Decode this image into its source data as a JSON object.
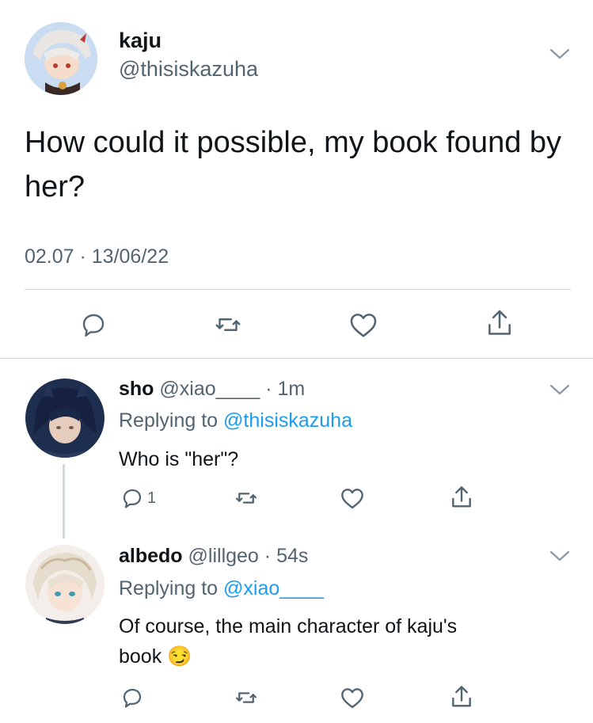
{
  "main_tweet": {
    "display_name": "kaju",
    "handle": "@thisiskazuha",
    "text": "How could it possible, my book found by her?",
    "timestamp": "02.07 · 13/06/22",
    "actions": [
      "reply-icon",
      "retweet-icon",
      "like-icon",
      "share-icon"
    ]
  },
  "replies": [
    {
      "display_name": "sho",
      "handle": "@xiao____",
      "time": "· 1m",
      "replying_prefix": "Replying to ",
      "replying_to": "@thisiskazuha",
      "text": "Who is \"her\"?",
      "reply_count": "1"
    },
    {
      "display_name": "albedo",
      "handle": "@lillgeo",
      "time": "· 54s",
      "replying_prefix": "Replying to ",
      "replying_to": "@xiao____",
      "text_line1": "Of course, the main character of kaju's",
      "text_line2": "book",
      "emoji": "😏"
    }
  ],
  "colors": {
    "accent": "#1d9bf0",
    "muted": "#536471",
    "divider": "#cfd9de"
  }
}
